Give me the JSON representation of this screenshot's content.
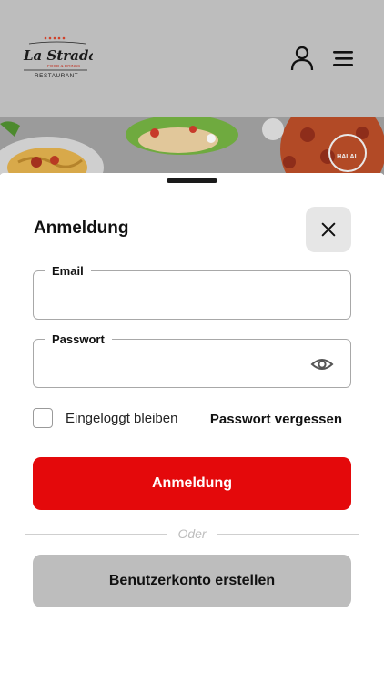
{
  "header": {
    "logo": {
      "line1": "La Strada",
      "line2": "FOOD & DRINKS",
      "line3": "RESTAURANT",
      "icon": "la-strada-logo"
    },
    "user_icon": "user-icon",
    "menu_icon": "hamburger-menu-icon"
  },
  "banner": {
    "badge": "HALAL"
  },
  "login": {
    "title": "Anmeldung",
    "close_icon": "close-icon",
    "email_label": "Email",
    "email_value": "",
    "password_label": "Passwort",
    "password_value": "",
    "eye_icon": "eye-icon",
    "remember_label": "Eingeloggt bleiben",
    "remember_checked": false,
    "forgot_label": "Passwort vergessen",
    "login_button": "Anmeldung",
    "divider_text": "Oder",
    "register_button": "Benutzerkonto erstellen"
  },
  "colors": {
    "primary": "#e4090b",
    "header_bg": "#bdbdbd",
    "secondary_button": "#bdbdbd",
    "close_bg": "#e6e6e6"
  }
}
